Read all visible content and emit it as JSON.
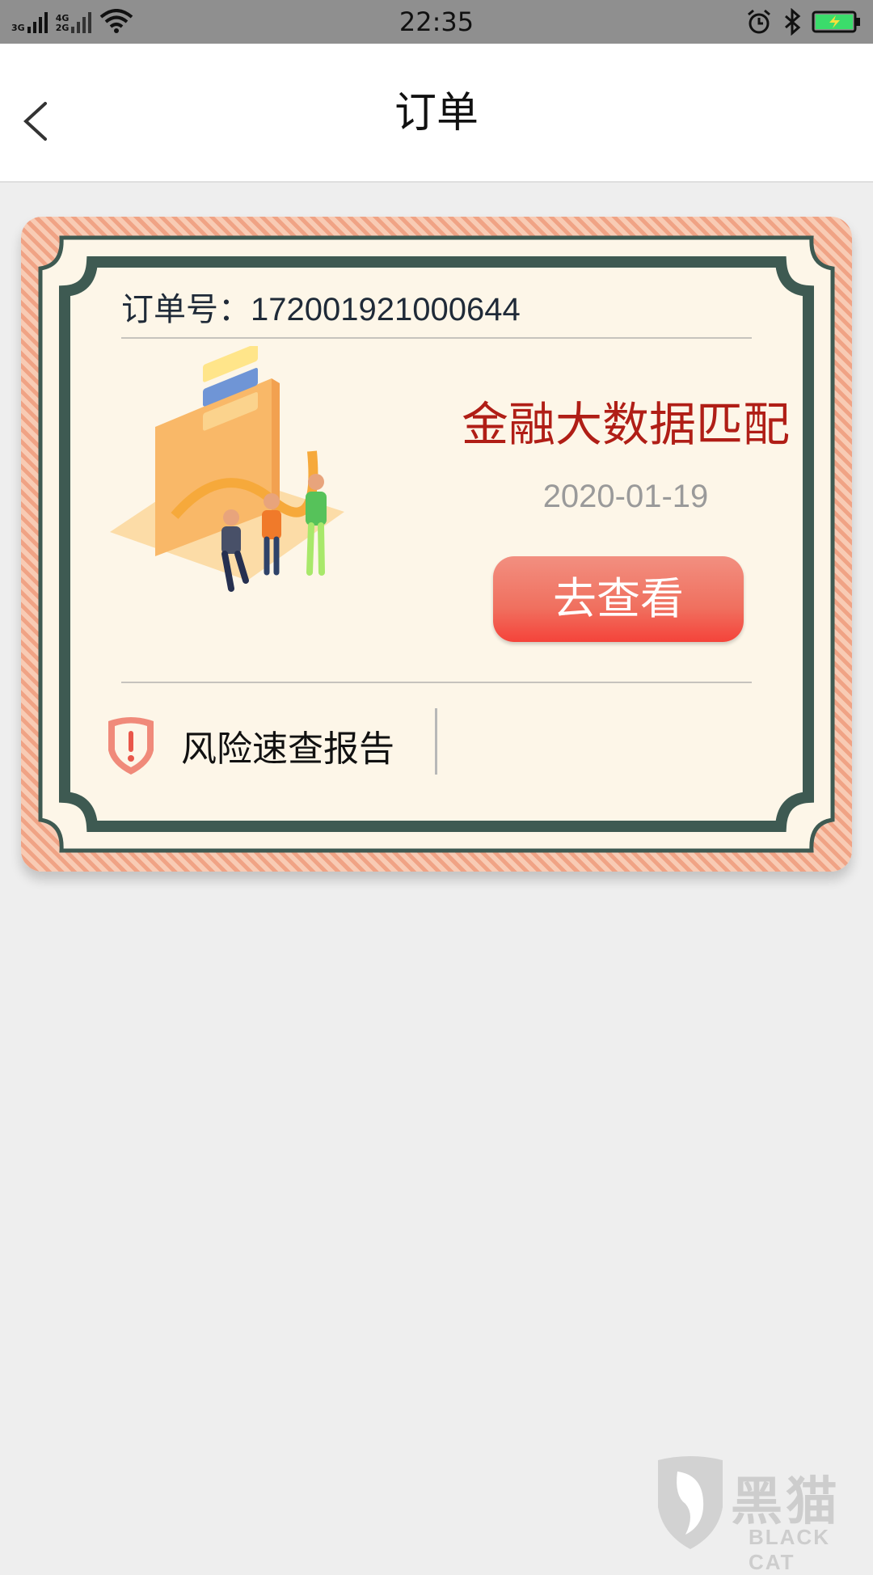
{
  "status_bar": {
    "network_top": "3G",
    "network_4g": "4G",
    "network_2g": "2G",
    "time": "22:35"
  },
  "nav": {
    "title": "订单"
  },
  "order": {
    "number_label": "订单号：",
    "number": "172001921000644",
    "product_title": "金融大数据匹配",
    "date": "2020-01-19",
    "view_button": "去查看",
    "risk_report_label": "风险速查报告"
  },
  "watermark": {
    "text_cn": "黑猫",
    "text_en": "BLACK CAT"
  },
  "colors": {
    "product_title": "#b01e16",
    "button": "#f0705f",
    "card_frame": "#3e5a52",
    "card_bg": "#fdf6e8",
    "stripes": "#f0a385"
  },
  "icons": [
    "back-arrow-icon",
    "wifi-icon",
    "alarm-icon",
    "bluetooth-icon",
    "battery-icon",
    "shield-warning-icon",
    "black-cat-logo"
  ]
}
